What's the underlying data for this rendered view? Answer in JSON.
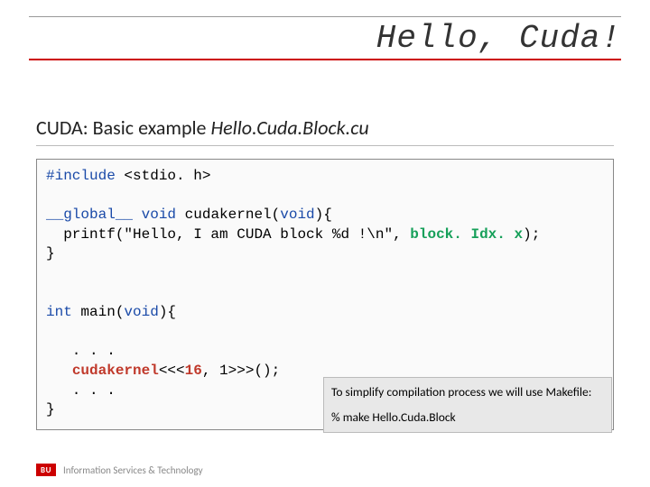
{
  "title": "Hello, Cuda!",
  "subtitle_prefix": "CUDA: Basic example  ",
  "subtitle_file": "Hello.Cuda.Block.cu",
  "code": {
    "l1a": "#include",
    "l1b": " <stdio. h>",
    "l2a": "__global__",
    "l2b": " void",
    "l2c": " cudakernel(",
    "l2d": "void",
    "l2e": "){",
    "l3a": "  printf(\"Hello, I am CUDA block %d !\\n\", ",
    "l3b": "block. Idx. x",
    "l3c": ");",
    "l4": "}",
    "l5a": "int",
    "l5b": " main(",
    "l5c": "void",
    "l5d": "){",
    "l6": "   . . .",
    "l7a": "   ",
    "l7b": "cudakernel",
    "l7c": "<<<",
    "l7d": "16",
    "l7e": ", 1>>>();",
    "l8": "   . . .",
    "l9": "}"
  },
  "note1": "To simplify compilation process we will use Makefile:",
  "note2": "% make Hello.Cuda.Block",
  "footer_logo": "BU",
  "footer_text": "Information Services & Technology"
}
